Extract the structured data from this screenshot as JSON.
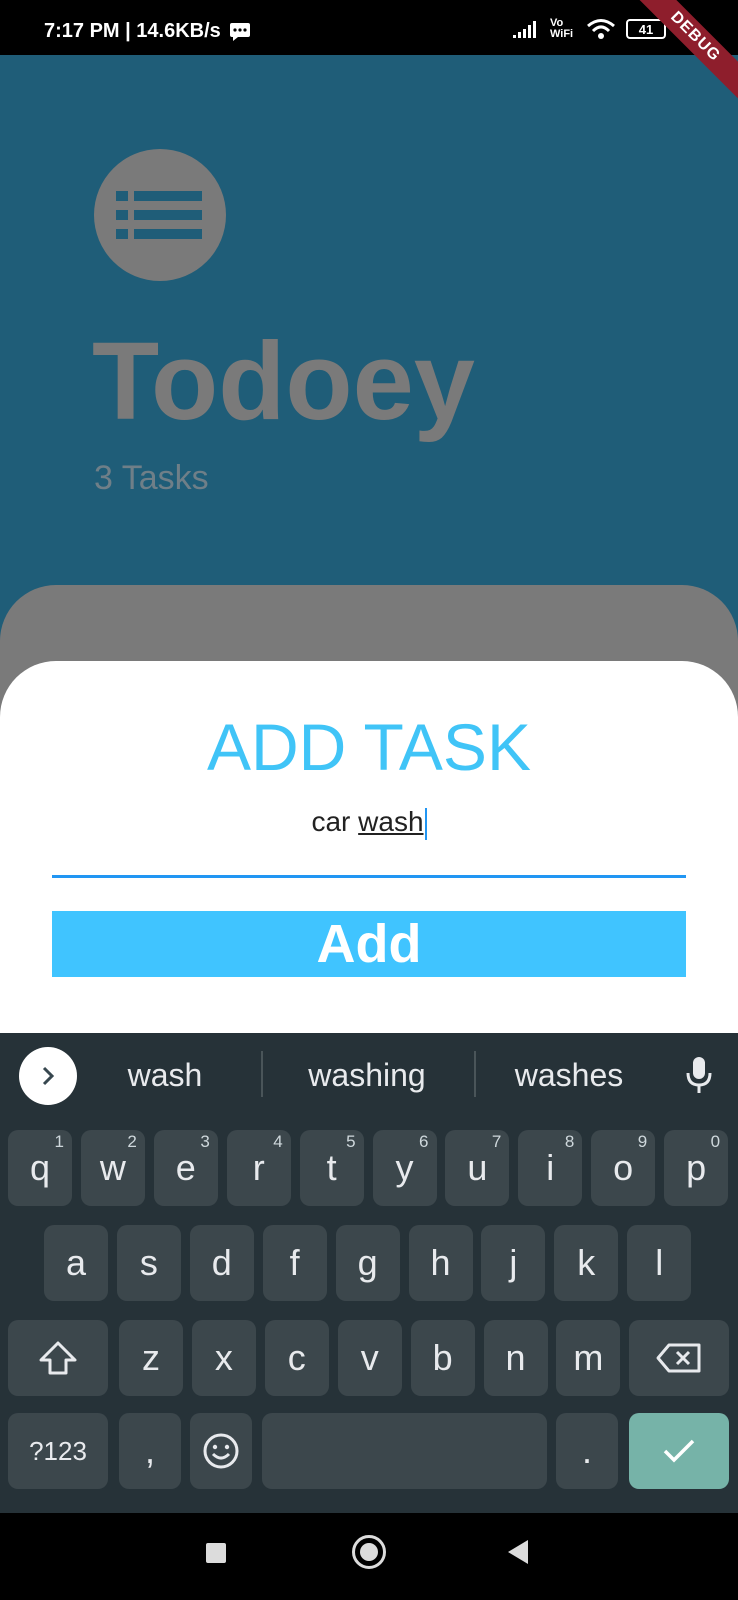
{
  "status_bar": {
    "time_speed": "7:17 PM | 14.6KB/s",
    "network_label": "Vo WiFi",
    "battery": "41",
    "debug_banner": "DEBUG"
  },
  "app": {
    "title": "Todoey",
    "task_count": "3 Tasks"
  },
  "modal": {
    "title": "ADD TASK",
    "input_prefix": "car ",
    "input_current_word": "wash",
    "add_label": "Add"
  },
  "keyboard": {
    "suggestions": [
      "wash",
      "washing",
      "washes"
    ],
    "row1": [
      {
        "k": "q",
        "h": "1"
      },
      {
        "k": "w",
        "h": "2"
      },
      {
        "k": "e",
        "h": "3"
      },
      {
        "k": "r",
        "h": "4"
      },
      {
        "k": "t",
        "h": "5"
      },
      {
        "k": "y",
        "h": "6"
      },
      {
        "k": "u",
        "h": "7"
      },
      {
        "k": "i",
        "h": "8"
      },
      {
        "k": "o",
        "h": "9"
      },
      {
        "k": "p",
        "h": "0"
      }
    ],
    "row2": [
      "a",
      "s",
      "d",
      "f",
      "g",
      "h",
      "j",
      "k",
      "l"
    ],
    "row3": [
      "z",
      "x",
      "c",
      "v",
      "b",
      "n",
      "m"
    ],
    "symbols_label": "?123",
    "comma_label": ",",
    "period_label": "."
  },
  "colors": {
    "accent": "#40c4ff",
    "title_color": "#40c4f7",
    "app_background": "#1f5d78",
    "keyboard_bg": "#263238",
    "enter_key": "#76b3a8"
  }
}
